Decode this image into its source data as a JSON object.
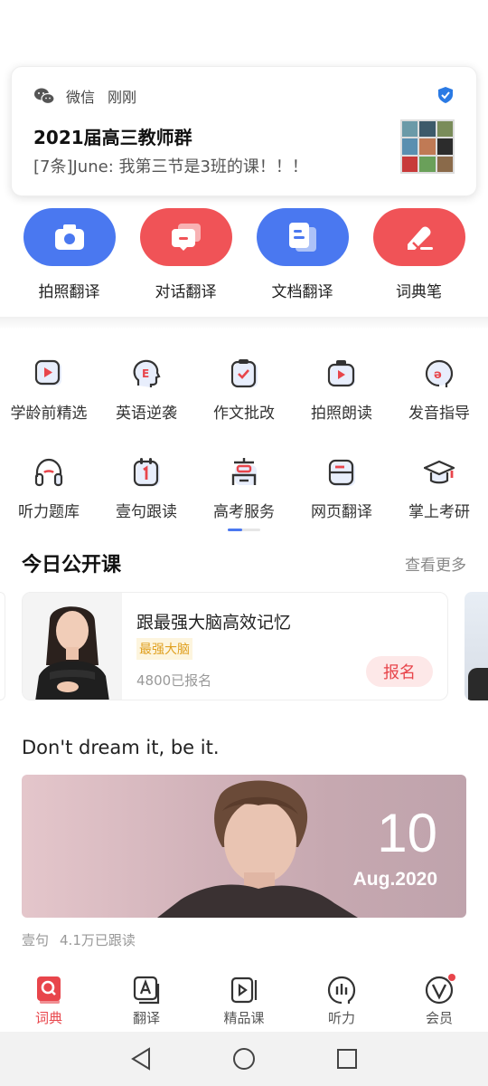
{
  "notification": {
    "app_name": "微信",
    "time": "刚刚",
    "title": "2021届高三教师群",
    "message": "[7条]June: 我第三节是3班的课！！！"
  },
  "tools": [
    {
      "label": "拍照翻译",
      "icon": "camera-icon",
      "color": "#4a78f0"
    },
    {
      "label": "对话翻译",
      "icon": "chat-icon",
      "color": "#f05357"
    },
    {
      "label": "文档翻译",
      "icon": "document-icon",
      "color": "#4a78f0"
    },
    {
      "label": "词典笔",
      "icon": "pen-icon",
      "color": "#f05357"
    }
  ],
  "grid": [
    {
      "label": "学龄前精选",
      "icon": "play-video-icon"
    },
    {
      "label": "英语逆袭",
      "icon": "head-e-icon"
    },
    {
      "label": "作文批改",
      "icon": "check-clipboard-icon"
    },
    {
      "label": "拍照朗读",
      "icon": "camera-play-icon"
    },
    {
      "label": "发音指导",
      "icon": "pronunciation-icon"
    },
    {
      "label": "听力题库",
      "icon": "headphones-icon"
    },
    {
      "label": "壹句跟读",
      "icon": "calendar-one-icon"
    },
    {
      "label": "高考服务",
      "icon": "gaokao-icon"
    },
    {
      "label": "网页翻译",
      "icon": "web-icon"
    },
    {
      "label": "掌上考研",
      "icon": "graduation-cap-icon"
    }
  ],
  "section": {
    "title": "今日公开课",
    "more": "查看更多"
  },
  "course": {
    "title": "跟最强大脑高效记忆",
    "tag": "最强大脑",
    "count": "4800已报名",
    "button": "报名"
  },
  "daily": {
    "quote": "Don't dream it, be it.",
    "day": "10",
    "month_year": "Aug.2020",
    "source": "壹句",
    "followers": "4.1万已跟读"
  },
  "tabs": [
    {
      "label": "词典",
      "icon": "dictionary-icon",
      "active": true
    },
    {
      "label": "翻译",
      "icon": "translate-icon",
      "active": false
    },
    {
      "label": "精品课",
      "icon": "course-icon",
      "active": false
    },
    {
      "label": "听力",
      "icon": "listening-icon",
      "active": false
    },
    {
      "label": "会员",
      "icon": "vip-icon",
      "active": false
    }
  ],
  "colors": {
    "brand_blue": "#4a78f0",
    "brand_red": "#f05357",
    "accent_red": "#e8454b"
  }
}
